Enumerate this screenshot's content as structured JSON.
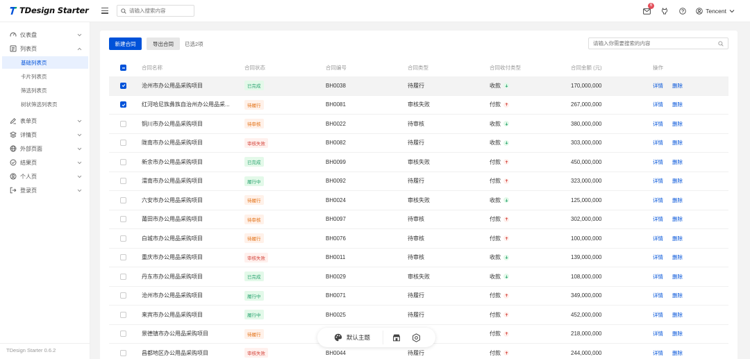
{
  "header": {
    "brand": "TDesign Starter",
    "search_placeholder": "请输入搜索内容",
    "notification_count": "6",
    "user_name": "Tencent"
  },
  "sidebar": {
    "items": [
      {
        "label": "仪表盘",
        "icon": "dashboard-icon",
        "expanded": false
      },
      {
        "label": "列表页",
        "icon": "list-icon",
        "expanded": true
      },
      {
        "label": "表单页",
        "icon": "edit-icon",
        "expanded": false
      },
      {
        "label": "详情页",
        "icon": "layers-icon",
        "expanded": false
      },
      {
        "label": "外部页面",
        "icon": "internet-icon",
        "expanded": false
      },
      {
        "label": "结果页",
        "icon": "check-circle-icon",
        "expanded": false
      },
      {
        "label": "个人页",
        "icon": "user-circle-icon",
        "expanded": false
      },
      {
        "label": "登录页",
        "icon": "login-icon",
        "expanded": false
      }
    ],
    "sub_items": [
      "基础列表页",
      "卡片列表页",
      "筛选列表页",
      "树状筛选列表页"
    ],
    "active_sub": "基础列表页",
    "version": "TDesign Starter 0.6.2"
  },
  "toolbar": {
    "new_label": "新建合同",
    "export_label": "导出合同",
    "selected_label": "已选2项",
    "search_placeholder": "请输入你需要搜索的内容"
  },
  "table": {
    "columns": [
      "合同名称",
      "合同状态",
      "合同编号",
      "合同类型",
      "合同收付类型",
      "合同金额 (元)",
      "操作"
    ],
    "detail_label": "详情",
    "delete_label": "删除",
    "rows": [
      {
        "name": "沧州市办公用品采购项目",
        "status": "已完成",
        "status_type": "success",
        "code": "BH0038",
        "type": "待履行",
        "pay": "收款",
        "pay_dir": "in",
        "amount": "170,000,000",
        "checked": true,
        "highlight": true
      },
      {
        "name": "红河哈尼族彝族自治州办公用品采...",
        "status": "待履行",
        "status_type": "warning",
        "code": "BH0081",
        "type": "审核失败",
        "pay": "付款",
        "pay_dir": "out",
        "amount": "267,000,000",
        "checked": true,
        "highlight": false
      },
      {
        "name": "铜川市办公用品采购项目",
        "status": "待审核",
        "status_type": "warning",
        "code": "BH0022",
        "type": "待审核",
        "pay": "收款",
        "pay_dir": "in",
        "amount": "380,000,000",
        "checked": false,
        "highlight": false
      },
      {
        "name": "陇南市办公用品采购项目",
        "status": "审核失败",
        "status_type": "error",
        "code": "BH0082",
        "type": "待履行",
        "pay": "收款",
        "pay_dir": "in",
        "amount": "303,000,000",
        "checked": false,
        "highlight": false
      },
      {
        "name": "新余市办公用品采购项目",
        "status": "已完成",
        "status_type": "success",
        "code": "BH0099",
        "type": "审核失败",
        "pay": "付款",
        "pay_dir": "out",
        "amount": "450,000,000",
        "checked": false,
        "highlight": false
      },
      {
        "name": "渭南市办公用品采购项目",
        "status": "履行中",
        "status_type": "process",
        "code": "BH0092",
        "type": "待履行",
        "pay": "付款",
        "pay_dir": "out",
        "amount": "323,000,000",
        "checked": false,
        "highlight": false
      },
      {
        "name": "六安市办公用品采购项目",
        "status": "待履行",
        "status_type": "warning",
        "code": "BH0024",
        "type": "审核失败",
        "pay": "收款",
        "pay_dir": "in",
        "amount": "125,000,000",
        "checked": false,
        "highlight": false
      },
      {
        "name": "莆田市办公用品采购项目",
        "status": "待审核",
        "status_type": "warning",
        "code": "BH0097",
        "type": "待审核",
        "pay": "付款",
        "pay_dir": "out",
        "amount": "302,000,000",
        "checked": false,
        "highlight": false
      },
      {
        "name": "白城市办公用品采购项目",
        "status": "待履行",
        "status_type": "warning",
        "code": "BH0076",
        "type": "待审核",
        "pay": "付款",
        "pay_dir": "out",
        "amount": "100,000,000",
        "checked": false,
        "highlight": false
      },
      {
        "name": "重庆市办公用品采购项目",
        "status": "审核失败",
        "status_type": "error",
        "code": "BH0011",
        "type": "待审核",
        "pay": "收款",
        "pay_dir": "in",
        "amount": "139,000,000",
        "checked": false,
        "highlight": false
      },
      {
        "name": "丹东市办公用品采购项目",
        "status": "已完成",
        "status_type": "success",
        "code": "BH0029",
        "type": "审核失败",
        "pay": "收款",
        "pay_dir": "in",
        "amount": "108,000,000",
        "checked": false,
        "highlight": false
      },
      {
        "name": "沧州市办公用品采购项目",
        "status": "履行中",
        "status_type": "process",
        "code": "BH0071",
        "type": "待履行",
        "pay": "付款",
        "pay_dir": "out",
        "amount": "349,000,000",
        "checked": false,
        "highlight": false
      },
      {
        "name": "来宾市办公用品采购项目",
        "status": "履行中",
        "status_type": "process",
        "code": "BH0025",
        "type": "待履行",
        "pay": "付款",
        "pay_dir": "out",
        "amount": "452,000,000",
        "checked": false,
        "highlight": false
      },
      {
        "name": "景德镇市办公用品采购项目",
        "status": "待履行",
        "status_type": "warning",
        "code": "",
        "type": "",
        "pay": "付款",
        "pay_dir": "out",
        "amount": "218,000,000",
        "checked": false,
        "highlight": false
      },
      {
        "name": "昌都地区办公用品采购项目",
        "status": "审核失败",
        "status_type": "error",
        "code": "BH0044",
        "type": "待履行",
        "pay": "付款",
        "pay_dir": "out",
        "amount": "244,000,000",
        "checked": false,
        "highlight": false
      }
    ]
  },
  "theme_bar": {
    "theme_label": "默认主题"
  },
  "colors": {
    "brand": "#0052d9",
    "success": "#2ba471",
    "warning": "#e37318",
    "error": "#d54941"
  }
}
